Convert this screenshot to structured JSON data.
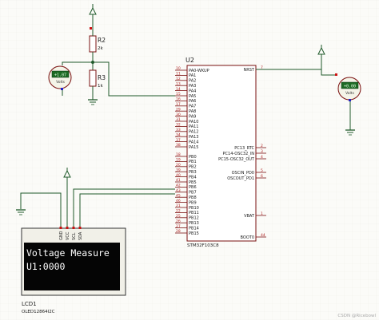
{
  "window": {
    "title": ""
  },
  "labels": {
    "u2": "U2",
    "u2_part": "STM32F103C8",
    "r2": "R2",
    "r2_val": "2k",
    "r3": "R3",
    "r3_val": "1k",
    "lcd": "LCD1",
    "lcd_part": "OLED12864I2C",
    "watermark": "CSDN @Ricebowl"
  },
  "voltmeters": {
    "left": {
      "reading": "+1.07",
      "unit": "Volts"
    },
    "right": {
      "reading": "+0.00",
      "unit": "Volts"
    }
  },
  "oled": {
    "line1": "Voltage Measure",
    "line2": "U1:0000",
    "pins": [
      "GND",
      "VCC",
      "SCL",
      "SDA"
    ]
  },
  "left_pins": [
    {
      "num": "10",
      "name": "PA0-WKUP"
    },
    {
      "num": "11",
      "name": "PA1"
    },
    {
      "num": "12",
      "name": "PA2"
    },
    {
      "num": "13",
      "name": "PA3"
    },
    {
      "num": "14",
      "name": "PA4"
    },
    {
      "num": "15",
      "name": "PA5"
    },
    {
      "num": "16",
      "name": "PA6"
    },
    {
      "num": "17",
      "name": "PA7"
    },
    {
      "num": "29",
      "name": "PA8"
    },
    {
      "num": "30",
      "name": "PA9"
    },
    {
      "num": "31",
      "name": "PA10"
    },
    {
      "num": "32",
      "name": "PA11"
    },
    {
      "num": "33",
      "name": "PA12"
    },
    {
      "num": "34",
      "name": "PA13"
    },
    {
      "num": "37",
      "name": "PA14"
    },
    {
      "num": "38",
      "name": "PA15"
    },
    {
      "num": "18",
      "name": "PB0"
    },
    {
      "num": "19",
      "name": "PB1"
    },
    {
      "num": "20",
      "name": "PB2"
    },
    {
      "num": "39",
      "name": "PB3"
    },
    {
      "num": "40",
      "name": "PB4"
    },
    {
      "num": "41",
      "name": "PB5"
    },
    {
      "num": "42",
      "name": "PB6"
    },
    {
      "num": "43",
      "name": "PB7"
    },
    {
      "num": "45",
      "name": "PB8"
    },
    {
      "num": "46",
      "name": "PB9"
    },
    {
      "num": "21",
      "name": "PB10"
    },
    {
      "num": "22",
      "name": "PB11"
    },
    {
      "num": "25",
      "name": "PB12"
    },
    {
      "num": "26",
      "name": "PB13"
    },
    {
      "num": "27",
      "name": "PB14"
    },
    {
      "num": "28",
      "name": "PB15"
    }
  ],
  "right_pins": [
    {
      "num": "7",
      "name": "NRST"
    },
    {
      "num": "2",
      "name": "PC13_RTC"
    },
    {
      "num": "3",
      "name": "PC14-OSC32_IN"
    },
    {
      "num": "4",
      "name": "PC15-OSC32_OUT"
    },
    {
      "num": "5",
      "name": "OSCIN_PD0"
    },
    {
      "num": "6",
      "name": "OSCOUT_PD1"
    },
    {
      "num": "1",
      "name": "VBAT"
    },
    {
      "num": "44",
      "name": "BOOT0"
    }
  ]
}
